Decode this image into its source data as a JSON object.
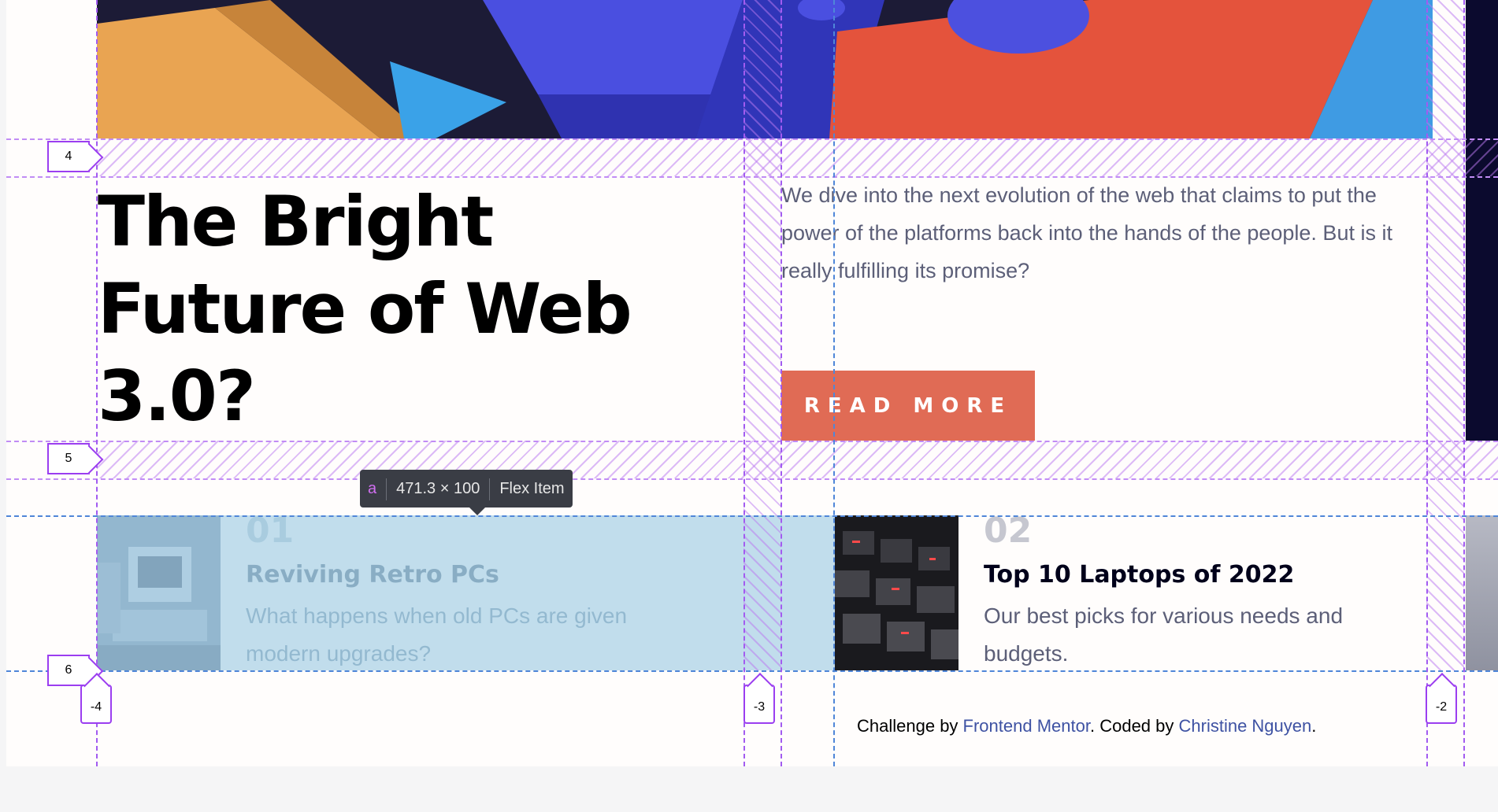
{
  "hero": {
    "title": "The Bright Future of Web 3.0?",
    "description": "We dive into the next evolution of the web that claims to put the power of the platforms back into the hands of the people. But is it really fulfilling its promise?",
    "button_label": "READ MORE"
  },
  "articles": [
    {
      "number": "01",
      "title": "Reviving Retro PCs",
      "description": "What happens when old PCs are given modern upgrades?"
    },
    {
      "number": "02",
      "title": "Top 10 Laptops of 2022",
      "description": "Our best picks for various needs and budgets."
    }
  ],
  "footer": {
    "prefix": "Challenge by ",
    "mentor_link": "Frontend Mentor",
    "middle": ". Coded by ",
    "author_link": "Christine Nguyen",
    "suffix": "."
  },
  "devtools": {
    "tooltip": {
      "selector": "a",
      "size": "471.3 × 100",
      "kind": "Flex Item"
    },
    "row_labels": [
      "4",
      "5",
      "6"
    ],
    "column_labels": [
      "-4",
      "-3",
      "-2"
    ]
  },
  "colors": {
    "accent": "#e06b55",
    "grid_overlay": "#a25bf0",
    "highlight": "#a0cde4"
  }
}
